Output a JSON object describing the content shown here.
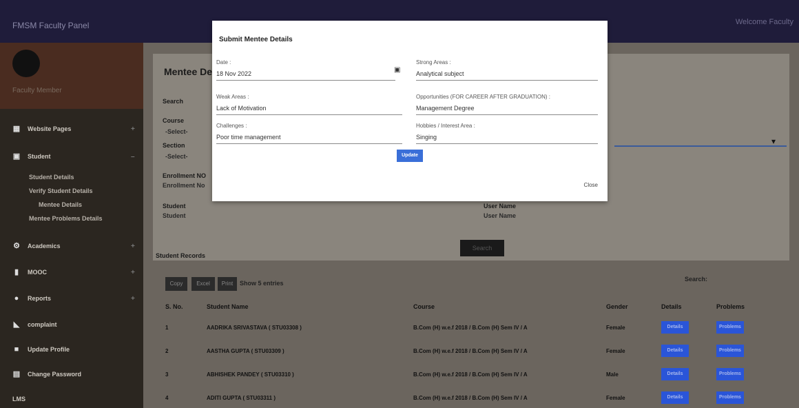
{
  "topbar": {
    "brand": "FMSM Faculty Panel",
    "right_text": "Welcome Faculty"
  },
  "sidebar": {
    "username": "Faculty Member",
    "items": [
      {
        "label": "Website Pages",
        "icon": "grid-icon"
      },
      {
        "label": "Student",
        "icon": "user-icon"
      },
      {
        "label": "Academics",
        "icon": "gear-icon"
      },
      {
        "label": "MOOC",
        "icon": "book-icon"
      },
      {
        "label": "Reports",
        "icon": "info-icon"
      },
      {
        "label": "complaint",
        "icon": "megaphone-icon"
      },
      {
        "label": "Update Profile",
        "icon": "folder-icon"
      },
      {
        "label": "Change Password",
        "icon": "lock-icon"
      },
      {
        "label": "LMS",
        "icon": ""
      }
    ],
    "sub_items": [
      "Student Details",
      "Verify Student Details",
      "Mentee Details",
      "Mentee Problems Details"
    ]
  },
  "main": {
    "title": "Mentee Details",
    "search_label": "Search",
    "course_label": "Course",
    "course_value": "-Select-",
    "section_label": "Section",
    "section_value": "-Select-",
    "enrollment_label": "Enrollment NO",
    "enrollment_value": "Enrollment No",
    "student_label": "Student",
    "student_value": "Student",
    "username_label": "User Name",
    "username_value": "User Name",
    "search_button": "Search",
    "records_title": "Student Records",
    "export": [
      "Copy",
      "Excel",
      "Print"
    ],
    "show_label": "Show",
    "show_value": "5",
    "entries_label": "entries",
    "table_search": "Search:",
    "columns": [
      "S. No.",
      "Student Name",
      "Course",
      "Gender",
      "Details",
      "Problems"
    ],
    "rows": [
      {
        "sno": "1",
        "name": "AADRIKA SRIVASTAVA ( STU03308 )",
        "course": "B.Com (H) w.e.f 2018 / B.Com (H) Sem IV / A",
        "gender": "Female",
        "details": "Details",
        "problems": "Problems"
      },
      {
        "sno": "2",
        "name": "AASTHA GUPTA ( STU03309 )",
        "course": "B.Com (H) w.e.f 2018 / B.Com (H) Sem IV / A",
        "gender": "Female",
        "details": "Details",
        "problems": "Problems"
      },
      {
        "sno": "3",
        "name": "ABHISHEK PANDEY ( STU03310 )",
        "course": "B.Com (H) w.e.f 2018 / B.Com (H) Sem IV / A",
        "gender": "Male",
        "details": "Details",
        "problems": "Problems"
      },
      {
        "sno": "4",
        "name": "ADITI GUPTA ( STU03311 )",
        "course": "B.Com (H) w.e.f 2018 / B.Com (H) Sem IV / A",
        "gender": "Female",
        "details": "Details",
        "problems": "Problems"
      }
    ]
  },
  "modal": {
    "title": "Submit Mentee Details",
    "date_label": "Date :",
    "date_value": "18 Nov 2022",
    "strong_label": "Strong Areas :",
    "strong_value": "Analytical subject",
    "weak_label": "Weak Areas :",
    "weak_value": "Lack of Motivation",
    "opp_label": "Opportunities (FOR CAREER AFTER GRADUATION) :",
    "opp_value": "Management Degree",
    "challenge_label": "Challenges :",
    "challenge_value": "Poor time management",
    "hobby_label": "Hobbies / Interest Area :",
    "hobby_value": "Singing",
    "update_button": "Update",
    "close_link": "Close"
  }
}
